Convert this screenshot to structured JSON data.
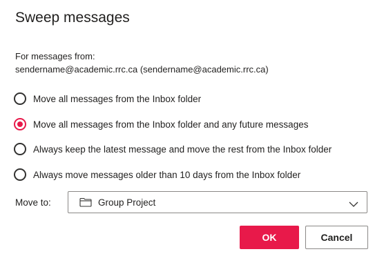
{
  "dialog": {
    "title": "Sweep messages",
    "from_label": "For messages from:",
    "from_address": "sendername@academic.rrc.ca (sendername@academic.rrc.ca)"
  },
  "options": [
    {
      "label": "Move all messages from the Inbox folder",
      "selected": false
    },
    {
      "label": "Move all messages from the Inbox folder and any future messages",
      "selected": true
    },
    {
      "label": "Always keep the latest message and move the rest from the Inbox folder",
      "selected": false
    },
    {
      "label": "Always move messages older than 10 days from the Inbox folder",
      "selected": false
    }
  ],
  "move_to": {
    "label": "Move to:",
    "value": "Group Project",
    "icon": "folder-icon"
  },
  "buttons": {
    "ok": "OK",
    "cancel": "Cancel"
  },
  "colors": {
    "accent": "#e8194a",
    "text": "#201f1e",
    "border": "#8a8886"
  }
}
